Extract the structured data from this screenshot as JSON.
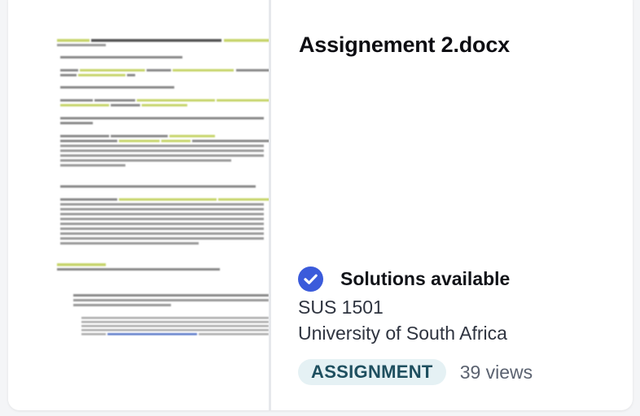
{
  "document": {
    "title": "Assignement 2.docx",
    "solutions_label": "Solutions available",
    "course_code": "SUS 1501",
    "university": "University of South Africa",
    "type_badge": "ASSIGNMENT",
    "views": "39 views"
  },
  "icons": {
    "solutions": "check-circle-icon"
  },
  "colors": {
    "check_icon": "#3b5bdb",
    "badge_bg": "#e5f1f4",
    "badge_text": "#1e4f5f",
    "highlight": "#c9d96b"
  }
}
